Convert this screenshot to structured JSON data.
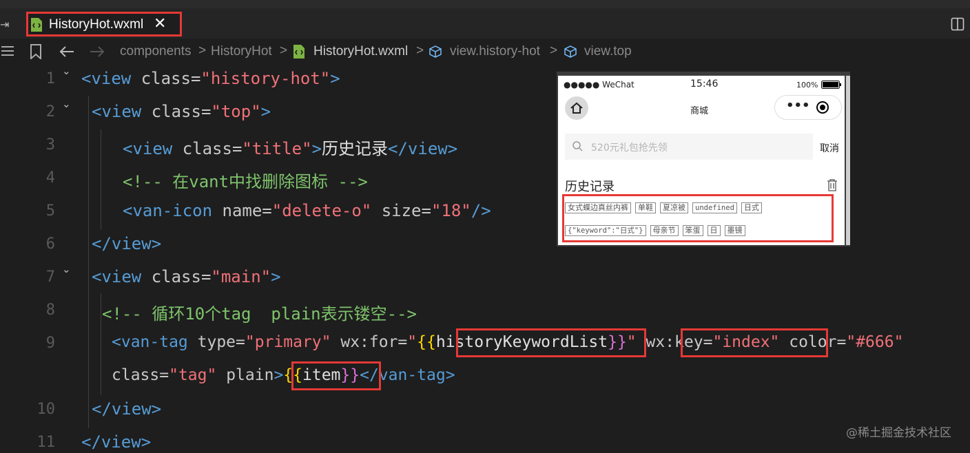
{
  "tab": {
    "file_name": "HistoryHot.wxml",
    "close": "✕"
  },
  "breadcrumb": {
    "items": [
      "components",
      "HistoryHot",
      "HistoryHot.wxml",
      "view.history-hot",
      "view.top"
    ],
    "separator": ">"
  },
  "code": {
    "line_numbers": [
      "1",
      "2",
      "3",
      "4",
      "5",
      "6",
      "7",
      "8",
      "9",
      "",
      "10",
      "11"
    ],
    "l1": {
      "open": "<view ",
      "attr": "class=",
      "val": "\"history-hot\"",
      "close": ">"
    },
    "l2": {
      "open": "<view ",
      "attr": "class=",
      "val": "\"top\"",
      "close": ">"
    },
    "l3": {
      "open": "<view ",
      "attr": "class=",
      "val": "\"title\"",
      "close": ">",
      "text": "历史记录",
      "end": "</view>"
    },
    "l4": {
      "comment": "<!-- 在vant中找删除图标 -->"
    },
    "l5": {
      "open": "<van-icon ",
      "attr1": "name=",
      "val1": "\"delete-o\"",
      "attr2": " size=",
      "val2": "\"18\"",
      "close": "/>"
    },
    "l6": {
      "end": "</view>"
    },
    "l7": {
      "open": "<view ",
      "attr": "class=",
      "val": "\"main\"",
      "close": ">"
    },
    "l8": {
      "comment": "<!-- 循环10个tag  plain表示镂空-->"
    },
    "l9": {
      "open": "<van-tag ",
      "attr1": "type=",
      "val1": "\"primary\"",
      "attr2": " wx:for=",
      "q1": "\"",
      "b_open": "{{",
      "var": "historyKeywordList",
      "b_close": "}}",
      "q2": "\"",
      "attr3": "wx:key=",
      "val3": "\"index\"",
      "attr4": " color=",
      "val4": "\"#666\""
    },
    "l9b": {
      "attr": "class=",
      "val": "\"tag\"",
      "plain": " plain",
      "close": ">",
      "b_open": "{{",
      "var": "item",
      "b_close": "}}",
      "end": "</van-tag>"
    },
    "l10": {
      "end": "</view>"
    },
    "l11": {
      "end": "</view>"
    }
  },
  "phone": {
    "carrier": "●●●●● WeChat",
    "time": "15:46",
    "battery": "100%",
    "nav_title": "商城",
    "capsule_dots": "•••",
    "search_placeholder": "520元礼包抢先领",
    "cancel": "取消",
    "history_title": "历史记录",
    "tags": [
      "女式蝶边真丝内裤",
      "单鞋",
      "夏凉被",
      "undefined",
      "日式",
      "{\"keyword\":\"日式\"}",
      "母亲节",
      "笨蛋",
      "日",
      "墨镜"
    ]
  },
  "watermark": "@稀土掘金技术社区",
  "colors": {
    "editor_bg": "#1e1e1e",
    "tag": "#569cd6",
    "string": "#f07178",
    "comment": "#7ec46b",
    "highlight": "#e53935"
  }
}
